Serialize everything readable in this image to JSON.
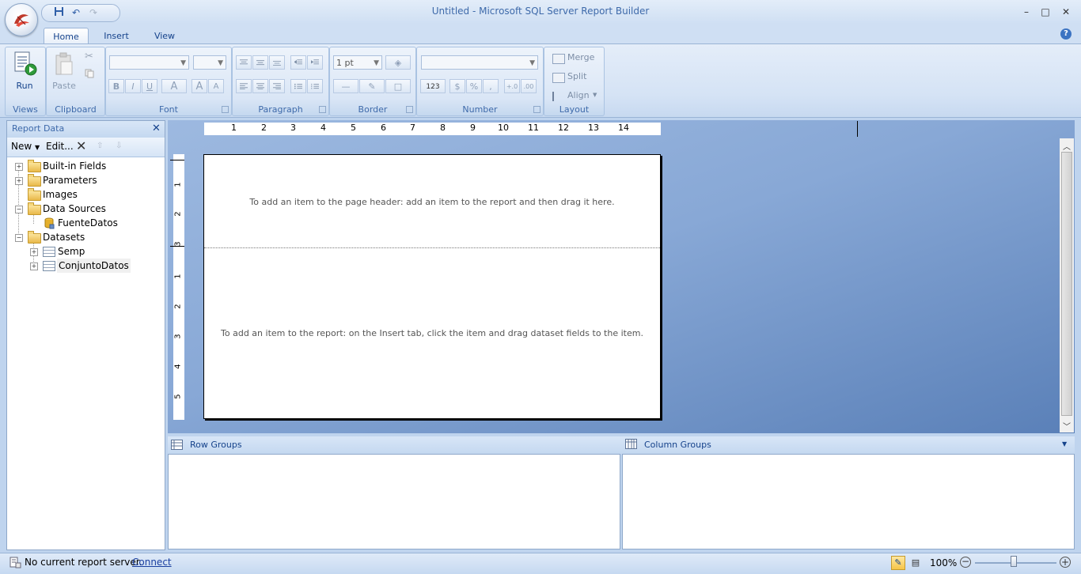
{
  "window": {
    "title": "Untitled - Microsoft SQL Server Report Builder",
    "minimize": "–",
    "maximize": "□",
    "close": "✕"
  },
  "ribbon": {
    "tabs": [
      "Home",
      "Insert",
      "View"
    ],
    "active_tab": "Home",
    "views": {
      "run_label": "Run",
      "group_label": "Views"
    },
    "clipboard": {
      "paste_label": "Paste",
      "group_label": "Clipboard"
    },
    "font": {
      "group_label": "Font",
      "bold": "B",
      "italic": "I",
      "underline": "U",
      "font_color": "A",
      "grow": "A",
      "shrink": "A"
    },
    "paragraph": {
      "group_label": "Paragraph"
    },
    "border": {
      "group_label": "Border",
      "width_value": "1 pt"
    },
    "number": {
      "group_label": "Number",
      "placeholder": "123",
      "currency": "$",
      "percent": "%",
      "comma": ","
    },
    "layout": {
      "group_label": "Layout",
      "merge": "Merge",
      "split": "Split",
      "align": "Align"
    },
    "help": "?"
  },
  "report_data": {
    "title": "Report Data",
    "toolbar": {
      "new_label": "New",
      "edit_label": "Edit..."
    },
    "tree": {
      "built_in_fields": "Built-in Fields",
      "parameters": "Parameters",
      "images": "Images",
      "data_sources": "Data Sources",
      "fuente_datos": "FuenteDatos",
      "datasets": "Datasets",
      "semp": "Semp",
      "conjunto_datos": "ConjuntoDatos"
    }
  },
  "design": {
    "hruler_numbers": [
      "1",
      "2",
      "3",
      "4",
      "5",
      "6",
      "7",
      "8",
      "9",
      "10",
      "11",
      "12",
      "13",
      "14"
    ],
    "vruler_header": [
      "1",
      "2",
      "3"
    ],
    "vruler_body": [
      "1",
      "2",
      "3",
      "4",
      "5"
    ],
    "header_hint": "To add an item to the page header: add an item to the report and then drag it here.",
    "body_hint": "To add an item to the report: on the Insert tab, click the item and drag dataset fields to the item."
  },
  "groups": {
    "row_groups": "Row Groups",
    "column_groups": "Column Groups"
  },
  "status": {
    "server_text": "No current report server.",
    "connect_link": "Connect",
    "zoom": "100%",
    "zoom_level_percent": 100
  }
}
